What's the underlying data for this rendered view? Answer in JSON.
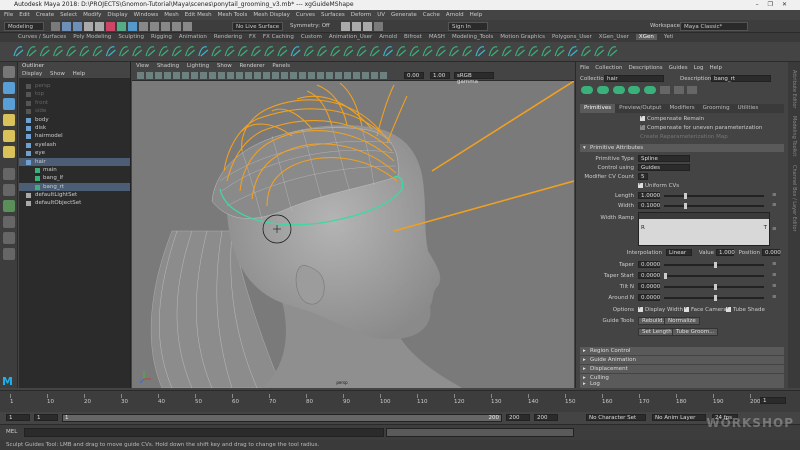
{
  "window": {
    "title": "Autodesk Maya 2018: D:\\PROJECTS\\Gnomon-Tutorial\\Maya\\scenes\\ponytail_grooming_v3.mb* --- xgGuideMShape",
    "controls": [
      "–",
      "❐",
      "✕"
    ]
  },
  "menubar": [
    "File",
    "Edit",
    "Create",
    "Select",
    "Modify",
    "Display",
    "Windows",
    "Mesh",
    "Edit Mesh",
    "Mesh Tools",
    "Mesh Display",
    "Curves",
    "Surfaces",
    "Deform",
    "UV",
    "Generate",
    "Cache",
    "Arnold",
    "Help"
  ],
  "statusline": {
    "menuset": "Modeling",
    "live_surface": "No Live Surface",
    "symmetry": "Symmetry: Off",
    "sign_in": "Sign In",
    "workspace_label": "Workspace :",
    "workspace": "Maya Classic*"
  },
  "shelf_tabs": [
    "Curves / Surfaces",
    "Poly Modeling",
    "Sculpting",
    "Rigging",
    "Animation",
    "Rendering",
    "FX",
    "FX Caching",
    "Custom",
    "Animation_User",
    "Arnold",
    "Bifrost",
    "MASH",
    "Modeling_Tools",
    "Motion Graphics",
    "Polygons_User",
    "XGen_User",
    "XGen",
    "Yeti"
  ],
  "shelf_active": "XGen",
  "outliner": {
    "title": "Outliner",
    "menu": [
      "Display",
      "Show",
      "Help"
    ],
    "items": [
      {
        "label": "persp",
        "dim": true,
        "indent": 0
      },
      {
        "label": "top",
        "dim": true,
        "indent": 0
      },
      {
        "label": "front",
        "dim": true,
        "indent": 0
      },
      {
        "label": "side",
        "dim": true,
        "indent": 0
      },
      {
        "label": "body",
        "dim": false,
        "indent": 0
      },
      {
        "label": "disk",
        "dim": false,
        "indent": 0
      },
      {
        "label": "hairmodel",
        "dim": false,
        "indent": 0
      },
      {
        "label": "eyelash",
        "dim": false,
        "indent": 0
      },
      {
        "label": "eye",
        "dim": false,
        "indent": 0
      },
      {
        "label": "hair",
        "dim": false,
        "indent": 0,
        "sel": true
      },
      {
        "label": "main",
        "dim": false,
        "indent": 1
      },
      {
        "label": "bang_lf",
        "dim": false,
        "indent": 1
      },
      {
        "label": "bang_rt",
        "dim": false,
        "indent": 1,
        "sel": true
      },
      {
        "label": "defaultLightSet",
        "dim": false,
        "indent": 0
      },
      {
        "label": "defaultObjectSet",
        "dim": false,
        "indent": 0
      }
    ]
  },
  "viewport": {
    "menu": [
      "View",
      "Shading",
      "Lighting",
      "Show",
      "Renderer",
      "Panels"
    ],
    "field1": "0.00",
    "field2": "1.00",
    "color_space": "sRGB gamma",
    "camera_label": "persp"
  },
  "xgen": {
    "menu": [
      "File",
      "Collection",
      "Descriptions",
      "Guides",
      "Log",
      "Help"
    ],
    "collection_label": "Collection",
    "collection": "hair",
    "description_label": "Description",
    "description": "bang_rt",
    "tabs": [
      "Primitives",
      "Preview/Output",
      "Modifiers",
      "Grooming",
      "Utilities",
      "Expressions"
    ],
    "active_tab": "Primitives",
    "compensate_remain": "Compensate Remain",
    "compensate_uneven": "Compensate for uneven parameterization",
    "create_reparam": "Create Reparameterization Map",
    "section_primitive": "Primitive Attributes",
    "primitive_type_label": "Primitive Type",
    "primitive_type": "Spline",
    "control_using_label": "Control using",
    "control_using": "Guides",
    "modifier_cv_label": "Modifier CV Count",
    "modifier_cv": "5",
    "uniform_cvs": "Uniform CVs",
    "length_label": "Length",
    "length": "1.0000",
    "width_label": "Width",
    "width": "0.1000",
    "width_ramp_label": "Width Ramp",
    "ramp_left": "R",
    "ramp_right": "T",
    "interpolation_label": "Interpolation",
    "interpolation": "Linear",
    "value_label": "Value",
    "value": "1.000",
    "position_label": "Position",
    "position": "0.000",
    "taper_label": "Taper",
    "taper": "0.0000",
    "taper_start_label": "Taper Start",
    "taper_start": "0.0000",
    "tilt_n_label": "Tilt N",
    "tilt_n": "0.0000",
    "around_n_label": "Around N",
    "around_n": "0.0000",
    "options_label": "Options",
    "display_width": "Display Width",
    "face_camera": "Face Camera",
    "tube_shade": "Tube Shade",
    "guide_tools_label": "Guide Tools",
    "rebuild": "Rebuild...",
    "normalize": "Normalize",
    "set_length": "Set Length...",
    "tube_groom": "Tube Groom...",
    "sections": [
      "Region Control",
      "Guide Animation",
      "Displacement",
      "Culling"
    ],
    "log": "Log"
  },
  "side_tabs": [
    "Attribute Editor",
    "Modeling Toolkit",
    "Channel Box / Layer Editor"
  ],
  "timeline": {
    "ticks": [
      "1",
      "10",
      "20",
      "30",
      "40",
      "50",
      "60",
      "70",
      "80",
      "90",
      "100",
      "110",
      "120",
      "130",
      "140",
      "150",
      "160",
      "170",
      "180",
      "190",
      "200"
    ],
    "current_frame": "1",
    "range_start": "1",
    "range_inner_start": "1",
    "range_inner_end": "200",
    "range_end_a": "200",
    "range_end_b": "200",
    "character_set": "No Character Set",
    "anim_layer": "No Anim Layer",
    "fps": "24 fps"
  },
  "mel_label": "MEL",
  "help_line": "Sculpt Guides Tool: LMB and drag to move guide CVs. Hold down the shift key and drag to change the tool radius.",
  "watermark": "WORKSHOP",
  "colors": {
    "guide_orange": "#f0a020",
    "selected_green": "#40d8a0",
    "mesh_gray": "#9a9a9a",
    "selection_blue": "#4b5e76"
  }
}
